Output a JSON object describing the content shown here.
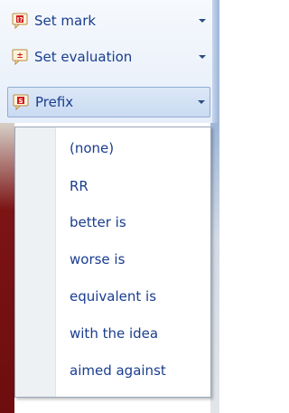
{
  "toolbar": {
    "items": [
      {
        "label": "Set mark",
        "icon": "set-mark-icon",
        "icon_color": "#c21a1a"
      },
      {
        "label": "Set evaluation",
        "icon": "set-evaluation-icon",
        "icon_color": "#c21a1a"
      },
      {
        "label": "Prefix",
        "icon": "prefix-icon",
        "icon_color": "#c21a1a",
        "active": true
      }
    ]
  },
  "prefix_menu": {
    "items": [
      "(none)",
      "RR",
      "better is",
      "worse is",
      "equivalent is",
      "with the idea",
      "aimed against"
    ]
  },
  "colors": {
    "text": "#1a3d8f",
    "active_bg": "#c9daf2",
    "active_border": "#90acd6"
  }
}
